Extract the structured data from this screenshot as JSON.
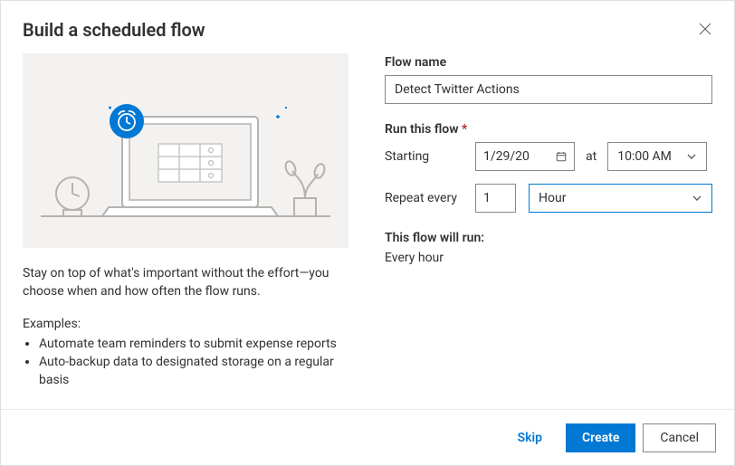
{
  "dialog": {
    "title": "Build a scheduled flow"
  },
  "left": {
    "description": "Stay on top of what's important without the effort—you choose when and how often the flow runs.",
    "examples_heading": "Examples:",
    "examples": [
      "Automate team reminders to submit expense reports",
      "Auto-backup data to designated storage on a regular basis"
    ]
  },
  "form": {
    "flow_name_label": "Flow name",
    "flow_name_value": "Detect Twitter Actions",
    "run_this_flow_label": "Run this flow",
    "starting_label": "Starting",
    "starting_date": "1/29/20",
    "at_label": "at",
    "starting_time": "10:00 AM",
    "repeat_label": "Repeat every",
    "repeat_interval": "1",
    "repeat_unit": "Hour",
    "will_run_label": "This flow will run:",
    "will_run_text": "Every hour"
  },
  "footer": {
    "skip": "Skip",
    "create": "Create",
    "cancel": "Cancel"
  }
}
